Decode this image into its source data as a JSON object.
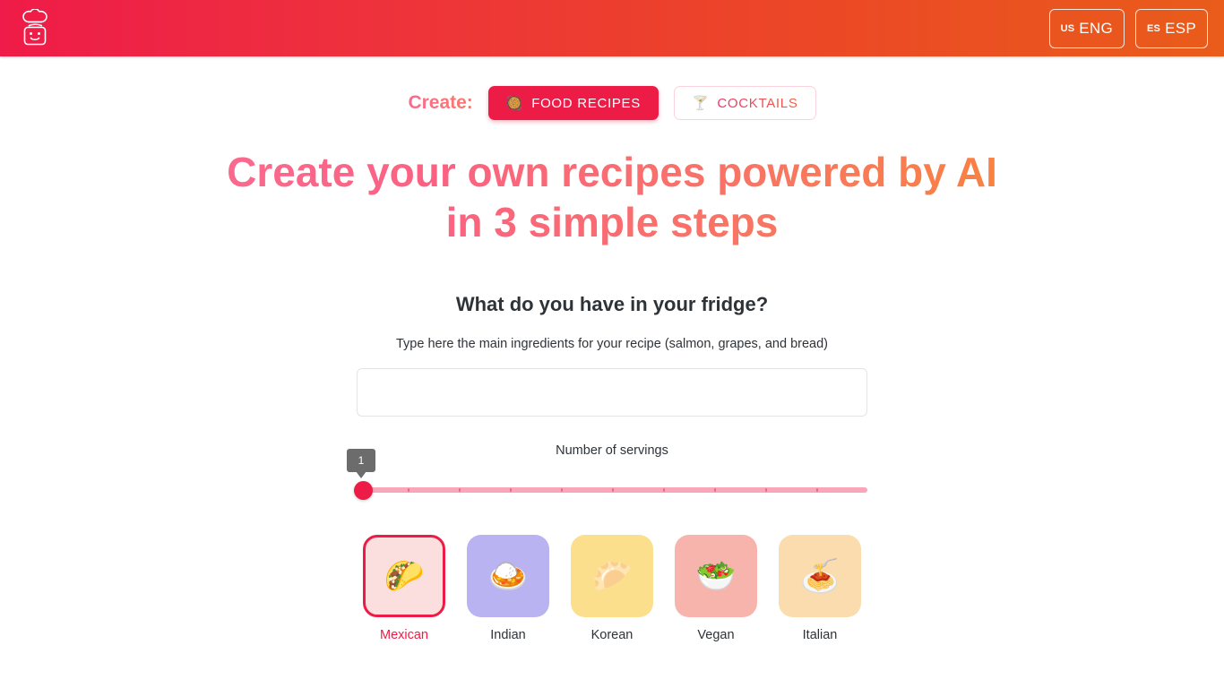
{
  "header": {
    "logo_icon": "chef-robot-logo-icon",
    "gradient_start": "#ef1b49",
    "gradient_end": "#e95c1a",
    "languages": [
      {
        "code": "US",
        "label": "ENG"
      },
      {
        "code": "ES",
        "label": "ESP"
      }
    ]
  },
  "create": {
    "label": "Create:",
    "tabs": [
      {
        "label": "FOOD RECIPES",
        "emoji": "🥘",
        "icon": "paella-icon",
        "active": true
      },
      {
        "label": "COCKTAILS",
        "emoji": "🍸",
        "icon": "cocktail-glass-icon",
        "active": false
      }
    ]
  },
  "headline": "Create your own recipes powered by AI in 3 simple steps",
  "form": {
    "title": "What do you have in your fridge?",
    "subtitle": "Type here the main ingredients for your recipe (salmon, grapes, and bread)",
    "ingredients_value": "",
    "ingredients_placeholder": ""
  },
  "slider": {
    "caption": "Number of servings",
    "value": "1",
    "min": 1,
    "max": 10,
    "tick_count": 9,
    "accent_color": "#ec1c47",
    "rail_color": "#f9a7b8"
  },
  "cuisines": [
    {
      "name": "Mexican",
      "emoji": "🌮",
      "icon": "taco-icon",
      "bg": "#fbdfdf",
      "selected": true
    },
    {
      "name": "Indian",
      "emoji": "🍛",
      "icon": "curry-rice-icon",
      "bg": "#b9b3f2",
      "selected": false
    },
    {
      "name": "Korean",
      "emoji": "🥟",
      "icon": "dumpling-icon",
      "bg": "#fbdf8d",
      "selected": false
    },
    {
      "name": "Vegan",
      "emoji": "🥗",
      "icon": "green-salad-icon",
      "bg": "#f7b4ad",
      "selected": false
    },
    {
      "name": "Italian",
      "emoji": "🍝",
      "icon": "spaghetti-icon",
      "bg": "#fadcae",
      "selected": false
    }
  ]
}
